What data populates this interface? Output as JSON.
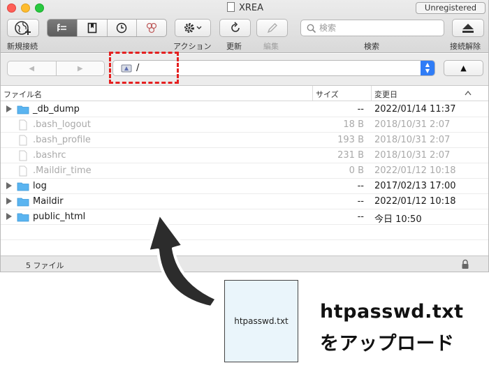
{
  "window": {
    "title": "XREA",
    "badge": "Unregistered"
  },
  "toolbar": {
    "new_connection_label": "新規接続",
    "action_label": "アクション",
    "refresh_label": "更新",
    "edit_label": "編集",
    "search_label": "検索",
    "search_placeholder": "検索",
    "disconnect_label": "接続解除"
  },
  "pathbar": {
    "path": "/",
    "back_glyph": "◀",
    "forward_glyph": "▶",
    "up_glyph": "▲"
  },
  "columns": {
    "name": "ファイル名",
    "size": "サイズ",
    "modified": "変更日"
  },
  "files": [
    {
      "name": "_db_dump",
      "size": "--",
      "date": "2022/01/14 11:37",
      "type": "folder",
      "hidden": false
    },
    {
      "name": ".bash_logout",
      "size": "18 B",
      "date": "2018/10/31 2:07",
      "type": "file",
      "hidden": true
    },
    {
      "name": ".bash_profile",
      "size": "193 B",
      "date": "2018/10/31 2:07",
      "type": "file",
      "hidden": true
    },
    {
      "name": ".bashrc",
      "size": "231 B",
      "date": "2018/10/31 2:07",
      "type": "file",
      "hidden": true
    },
    {
      "name": ".Maildir_time",
      "size": "0 B",
      "date": "2022/01/12 10:18",
      "type": "file",
      "hidden": true
    },
    {
      "name": "log",
      "size": "--",
      "date": "2017/02/13 17:00",
      "type": "folder",
      "hidden": false
    },
    {
      "name": "Maildir",
      "size": "--",
      "date": "2022/01/12 10:18",
      "type": "folder",
      "hidden": false
    },
    {
      "name": "public_html",
      "size": "--",
      "date": "今日 10:50",
      "type": "folder",
      "hidden": false
    }
  ],
  "status": {
    "count": "5 ファイル"
  },
  "annotation": {
    "file_label": "htpasswd.txt",
    "caption_line1": "htpasswd.txt",
    "caption_line2": "をアップロード",
    "highlight_color": "#e52020"
  },
  "colors": {
    "folder": "#5ab4f0",
    "accent": "#2f7cf6"
  }
}
